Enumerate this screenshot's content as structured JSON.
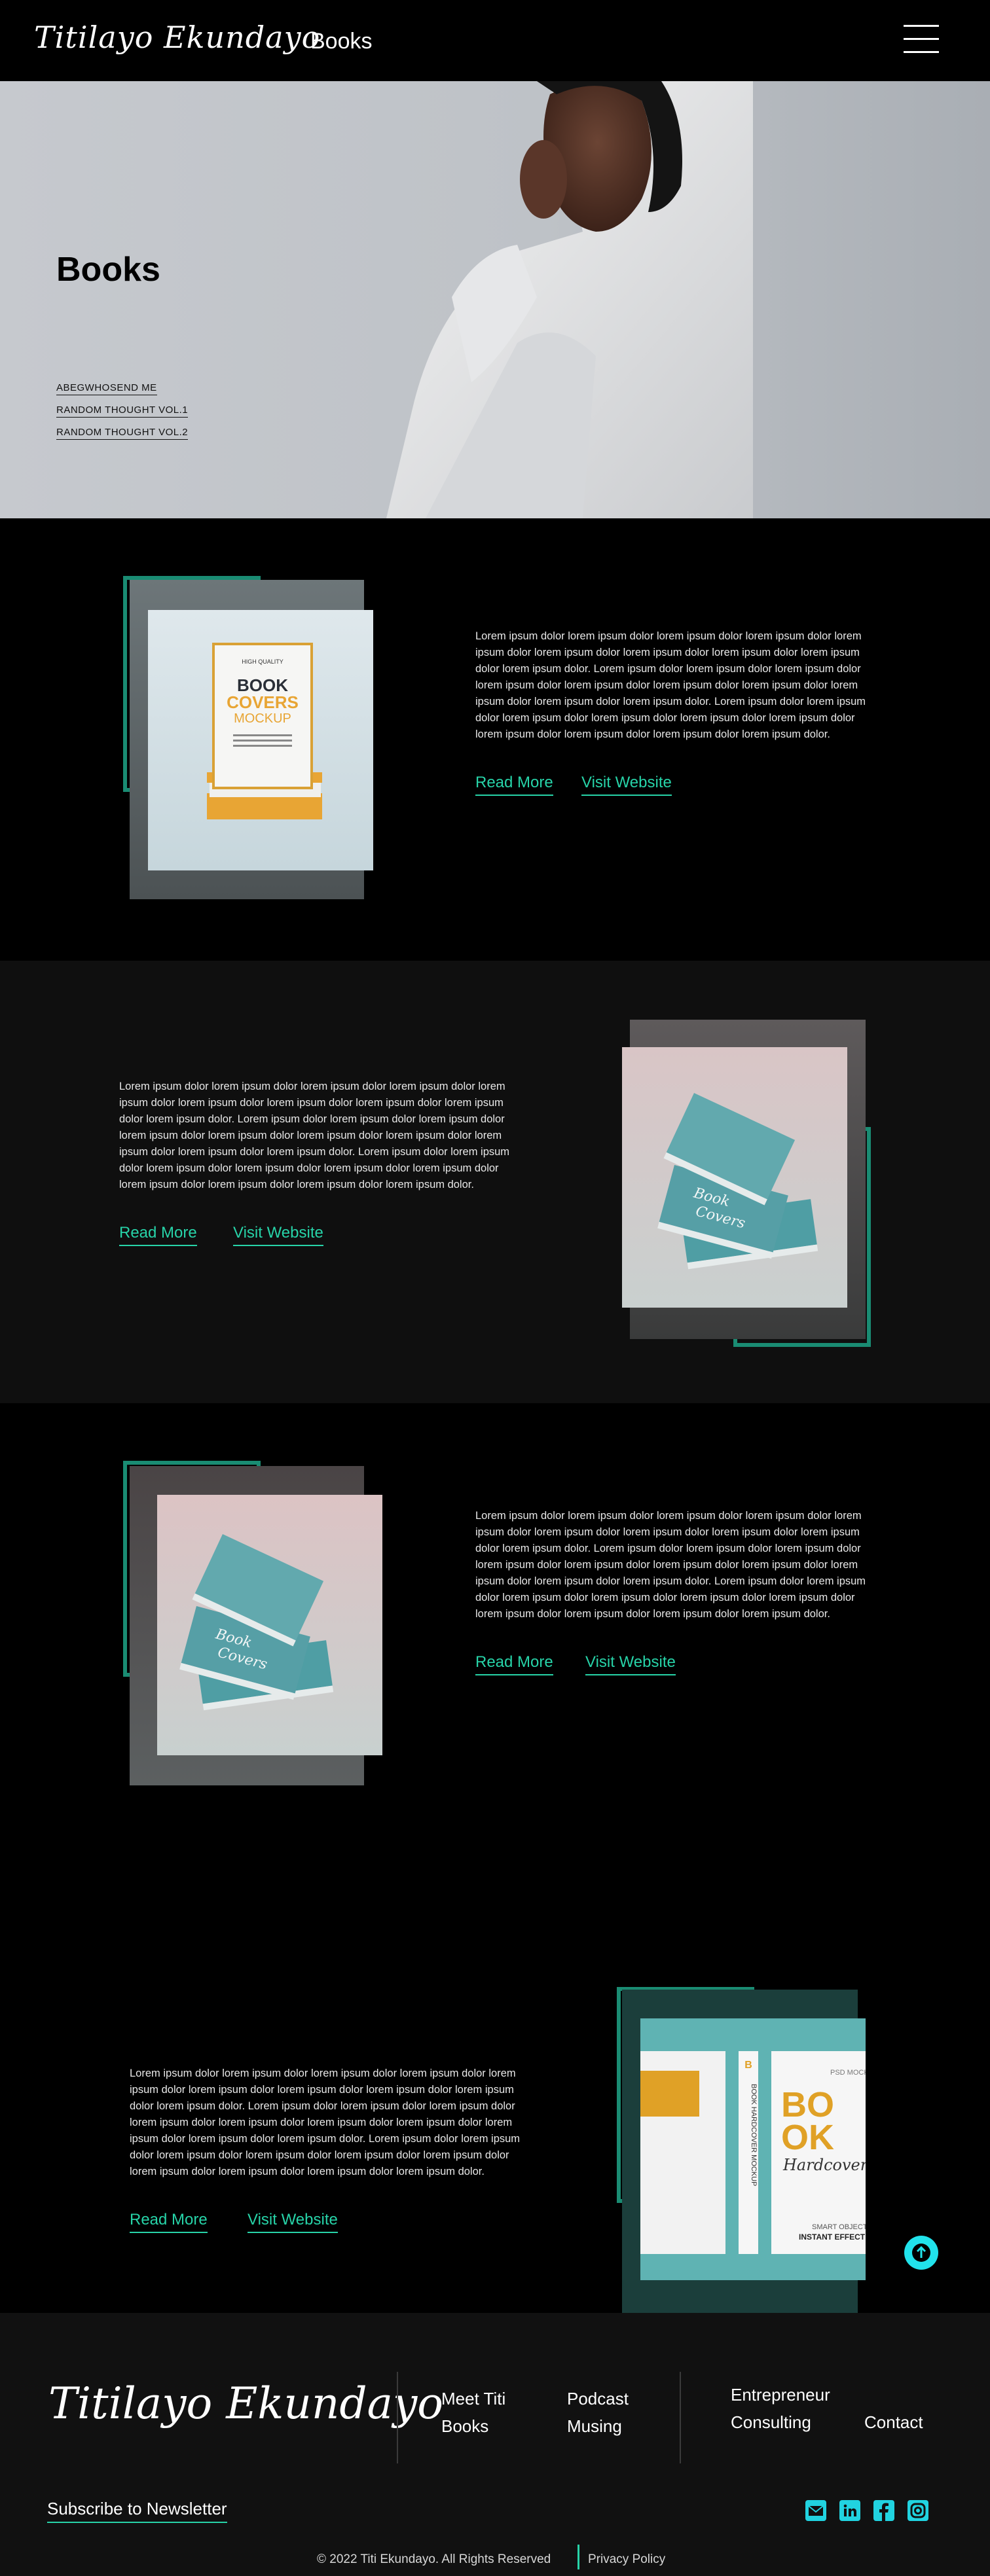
{
  "header": {
    "logo": "Titilayo Ekundayo",
    "nav_title": "Books"
  },
  "hero": {
    "title": "Books",
    "links": [
      "ABEGWHOSEND ME",
      "RANDOM THOUGHT VOL.1",
      "RANDOM THOUGHT VOL.2"
    ]
  },
  "books": [
    {
      "cover_text": [
        "HIGH QUALITY",
        "BOOK",
        "COVERS",
        "MOCKUP"
      ],
      "description": "Lorem ipsum dolor lorem ipsum dolor lorem ipsum dolor lorem ipsum dolor lorem ipsum dolor lorem ipsum dolor lorem ipsum dolor lorem ipsum dolor lorem ipsum dolor lorem ipsum dolor.  Lorem ipsum dolor lorem ipsum dolor lorem ipsum dolor lorem ipsum dolor lorem ipsum dolor lorem ipsum dolor lorem ipsum dolor lorem ipsum dolor lorem ipsum dolor lorem ipsum dolor.  Lorem ipsum dolor lorem ipsum dolor lorem ipsum dolor lorem ipsum dolor lorem ipsum dolor lorem ipsum dolor lorem ipsum dolor lorem ipsum dolor lorem ipsum dolor lorem ipsum dolor.",
      "read_more": "Read More",
      "visit_website": "Visit Website"
    },
    {
      "cover_text": [
        "Book",
        "Covers"
      ],
      "description": "Lorem ipsum dolor lorem ipsum dolor lorem ipsum dolor lorem ipsum dolor lorem ipsum dolor lorem ipsum dolor lorem ipsum dolor lorem ipsum dolor lorem ipsum dolor lorem ipsum dolor.  Lorem ipsum dolor lorem ipsum dolor lorem ipsum dolor lorem ipsum dolor lorem ipsum dolor lorem ipsum dolor lorem ipsum dolor lorem ipsum dolor lorem ipsum dolor lorem ipsum dolor.  Lorem ipsum dolor lorem ipsum dolor lorem ipsum dolor lorem ipsum dolor lorem ipsum dolor lorem ipsum dolor lorem ipsum dolor lorem ipsum dolor lorem ipsum dolor lorem ipsum dolor.",
      "read_more": "Read More",
      "visit_website": "Visit Website"
    },
    {
      "cover_text": [
        "Book",
        "Covers"
      ],
      "description": "Lorem ipsum dolor lorem ipsum dolor lorem ipsum dolor lorem ipsum dolor lorem ipsum dolor lorem ipsum dolor lorem ipsum dolor lorem ipsum dolor lorem ipsum dolor lorem ipsum dolor.  Lorem ipsum dolor lorem ipsum dolor lorem ipsum dolor lorem ipsum dolor lorem ipsum dolor lorem ipsum dolor lorem ipsum dolor lorem ipsum dolor lorem ipsum dolor lorem ipsum dolor.  Lorem ipsum dolor lorem ipsum dolor lorem ipsum dolor lorem ipsum dolor lorem ipsum dolor lorem ipsum dolor lorem ipsum dolor lorem ipsum dolor lorem ipsum dolor lorem ipsum dolor.",
      "read_more": "Read More",
      "visit_website": "Visit Website"
    },
    {
      "cover_text": [
        "PSD MOCKUP",
        "BO",
        "OK",
        "Hardcover",
        "SMART OBJECT",
        "INSTANT EFFECT",
        "BOOK HARDCOVER MOCKUP",
        "B"
      ],
      "description": "Lorem ipsum dolor lorem ipsum dolor lorem ipsum dolor lorem ipsum dolor lorem ipsum dolor lorem ipsum dolor lorem ipsum dolor lorem ipsum dolor lorem ipsum dolor lorem ipsum dolor.  Lorem ipsum dolor lorem ipsum dolor lorem ipsum dolor lorem ipsum dolor lorem ipsum dolor lorem ipsum dolor lorem ipsum dolor lorem ipsum dolor lorem ipsum dolor lorem ipsum dolor.  Lorem ipsum dolor lorem ipsum dolor lorem ipsum dolor lorem ipsum dolor lorem ipsum dolor lorem ipsum dolor lorem ipsum dolor lorem ipsum dolor lorem ipsum dolor lorem ipsum dolor.",
      "read_more": "Read More",
      "visit_website": "Visit Website"
    }
  ],
  "footer": {
    "logo": "Titilayo Ekundayo",
    "links": {
      "meet_titi": "Meet Titi",
      "books": "Books",
      "podcast": "Podcast",
      "musing": "Musing",
      "entrepreneur": "Entrepreneur",
      "consulting": "Consulting",
      "contact": "Contact"
    },
    "subscribe": "Subscribe to Newsletter",
    "social": [
      "mail-icon",
      "linkedin-icon",
      "facebook-icon",
      "instagram-icon"
    ],
    "copyright": "© 2022 Titi Ekundayo. All Rights Reserved",
    "privacy": "Privacy Policy"
  },
  "colors": {
    "accent": "#27d3a8",
    "frame": "#1a8c73",
    "back_to_top": "#21e3ec"
  }
}
